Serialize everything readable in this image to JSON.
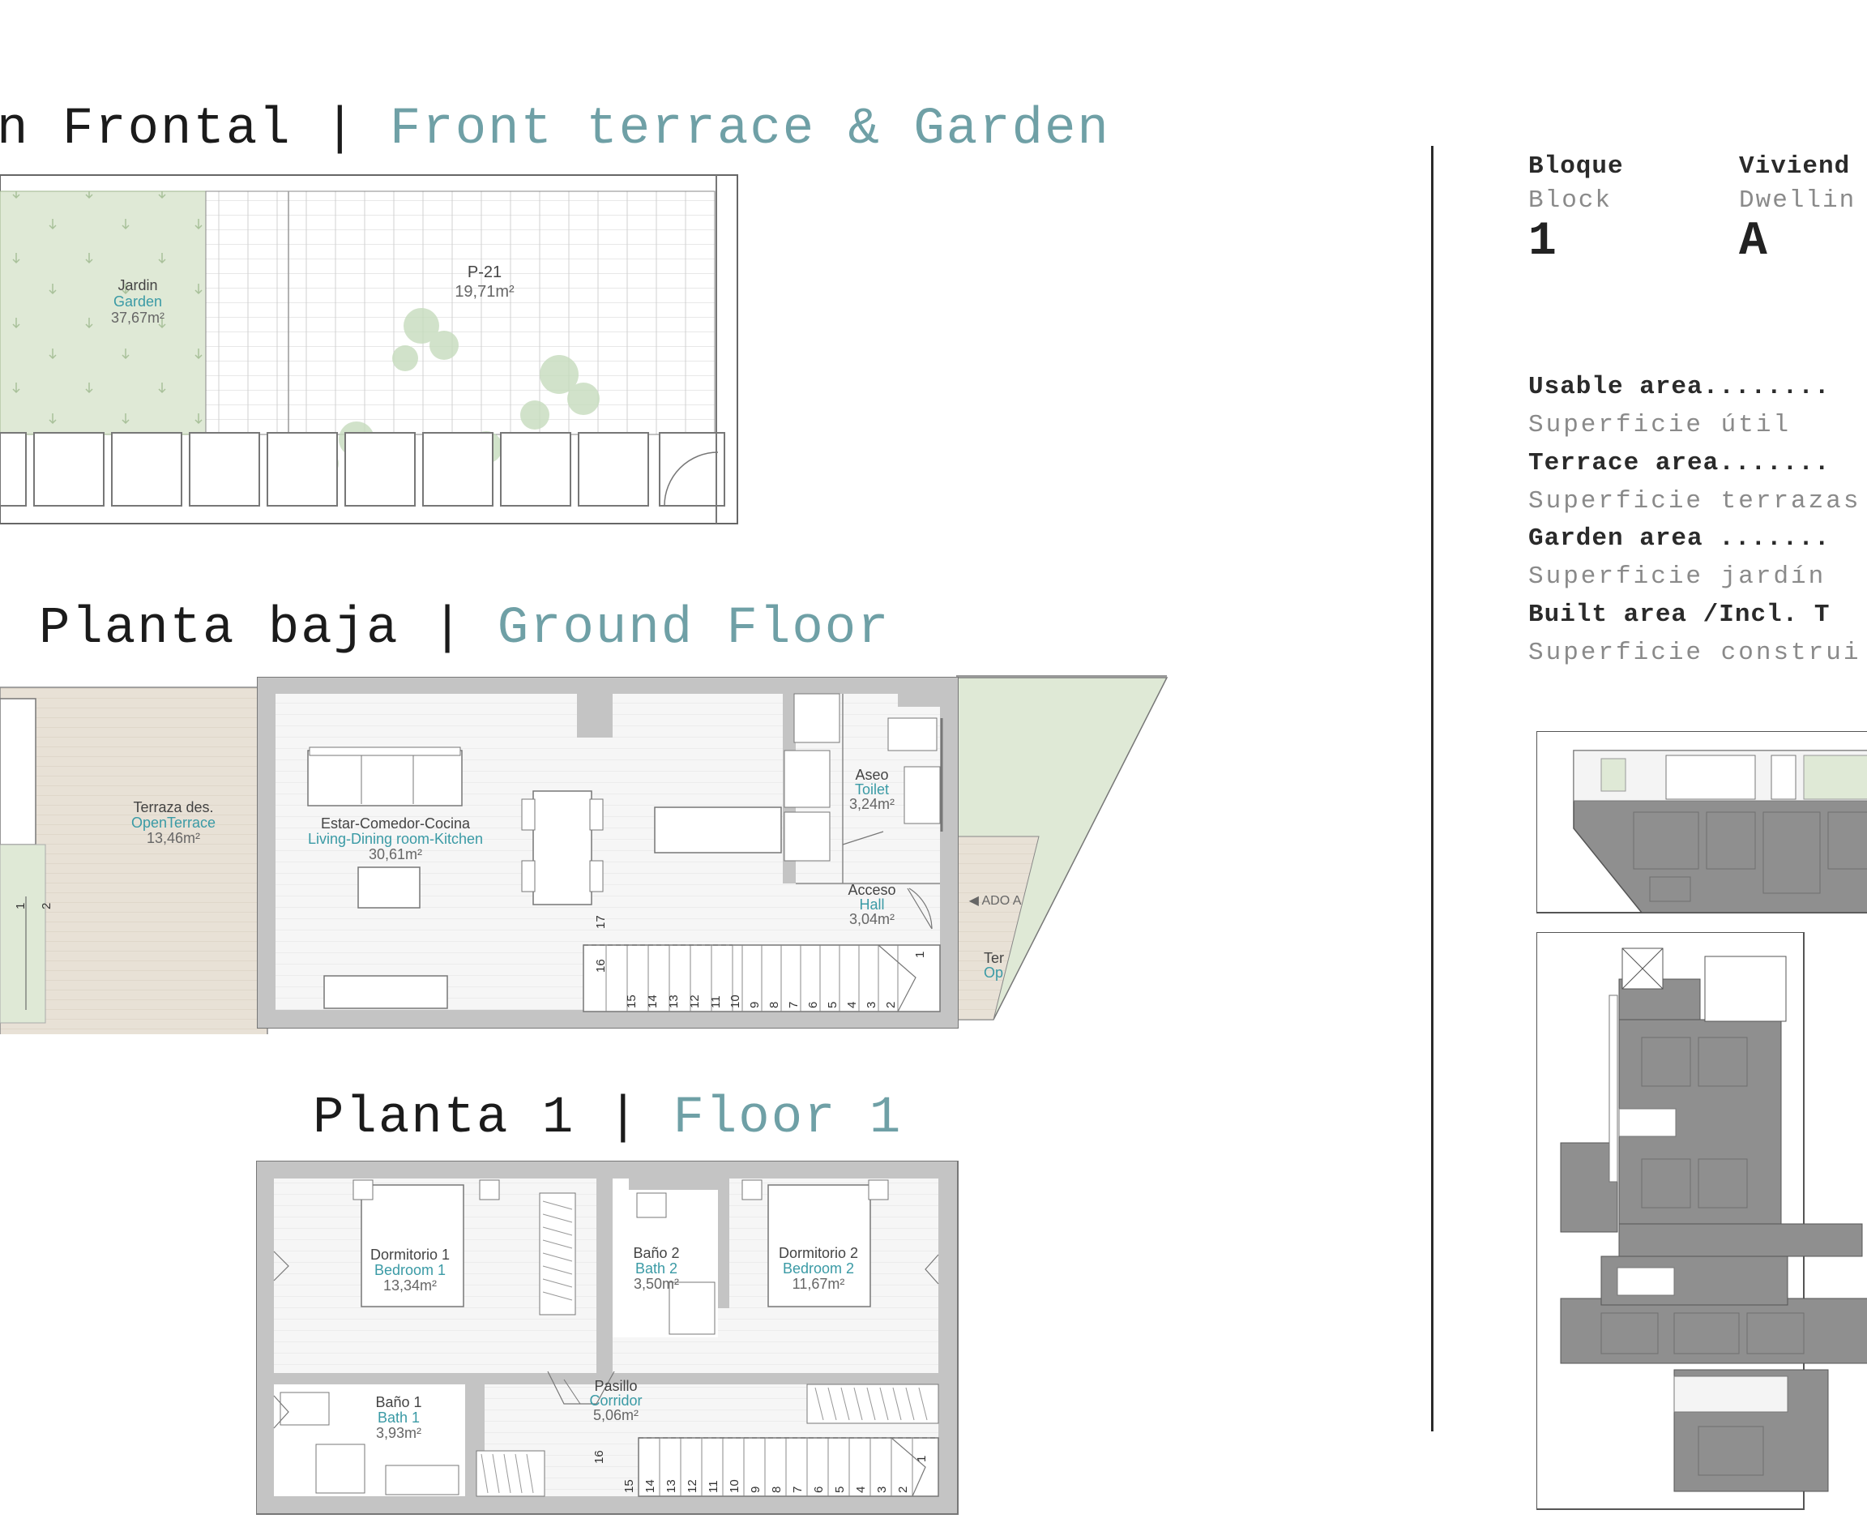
{
  "sections": {
    "terrace": {
      "es": "n Frontal",
      "sep": "|",
      "en": "Front terrace & Garden"
    },
    "ground": {
      "es": "Planta baja",
      "sep": "|",
      "en": "Ground Floor"
    },
    "floor1": {
      "es": "Planta 1",
      "sep": "|",
      "en": "Floor 1"
    }
  },
  "info": {
    "block_label": "Bloque",
    "block_sub": "Block",
    "block_value": "1",
    "dwelling_label": "Viviend",
    "dwelling_sub": "Dwellin",
    "dwelling_value": "A",
    "areas": [
      {
        "bold": "Usable area........",
        "light": "Superficie útil"
      },
      {
        "bold": "Terrace area.......",
        "light": "Superficie terrazas"
      },
      {
        "bold": "Garden area .......",
        "light": "Superficie jardín"
      },
      {
        "bold": "Built area /Incl. T",
        "light": "Superficie construi"
      }
    ]
  },
  "terrace_plan": {
    "garden": {
      "es": "Jardin",
      "en": "Garden",
      "area": "37,67m²"
    },
    "parking": {
      "es": "P-21",
      "area": "19,71m²"
    }
  },
  "ground_plan": {
    "open_terrace": {
      "es": "Terraza des.",
      "en": "OpenTerrace",
      "area": "13,46m²"
    },
    "living": {
      "es": "Estar-Comedor-Cocina",
      "en": "Living-Dining room-Kitchen",
      "area": "30,61m²"
    },
    "toilet": {
      "es": "Aseo",
      "en": "Toilet",
      "area": "3,24m²"
    },
    "hall": {
      "es": "Acceso",
      "en": "Hall",
      "area": "3,04m²"
    },
    "side_es": "Ter",
    "side_en": "Op",
    "ado": "◀ ADO A",
    "steps_bottom": [
      "15",
      "14",
      "13",
      "12",
      "11",
      "10",
      "9",
      "8",
      "7",
      "6",
      "5",
      "4",
      "3",
      "2"
    ],
    "steps_top": [
      "16",
      "17"
    ],
    "step_1": "1",
    "left_marks": [
      "1",
      "2"
    ]
  },
  "floor1_plan": {
    "bedroom1": {
      "es": "Dormitorio 1",
      "en": "Bedroom 1",
      "area": "13,34m²"
    },
    "bath2": {
      "es": "Baño 2",
      "en": "Bath 2",
      "area": "3,50m²"
    },
    "bedroom2": {
      "es": "Dormitorio 2",
      "en": "Bedroom 2",
      "area": "11,67m²"
    },
    "bath1": {
      "es": "Baño 1",
      "en": "Bath 1",
      "area": "3,93m²"
    },
    "corridor": {
      "es": "Pasillo",
      "en": "Corridor",
      "area": "5,06m²"
    },
    "steps_bottom": [
      "15",
      "14",
      "13",
      "12",
      "11",
      "10",
      "9",
      "8",
      "7",
      "6",
      "5",
      "4",
      "3",
      "2"
    ],
    "step_16": "16",
    "step_1": "1"
  },
  "colors": {
    "garden": "#dde8d3",
    "terrace_wood": "#e6dfd3",
    "wall": "#bdbdbd",
    "plan_dark": "#8c8c8c",
    "accent": "#3a9aa5",
    "heading_en": "#6fa0a6"
  }
}
